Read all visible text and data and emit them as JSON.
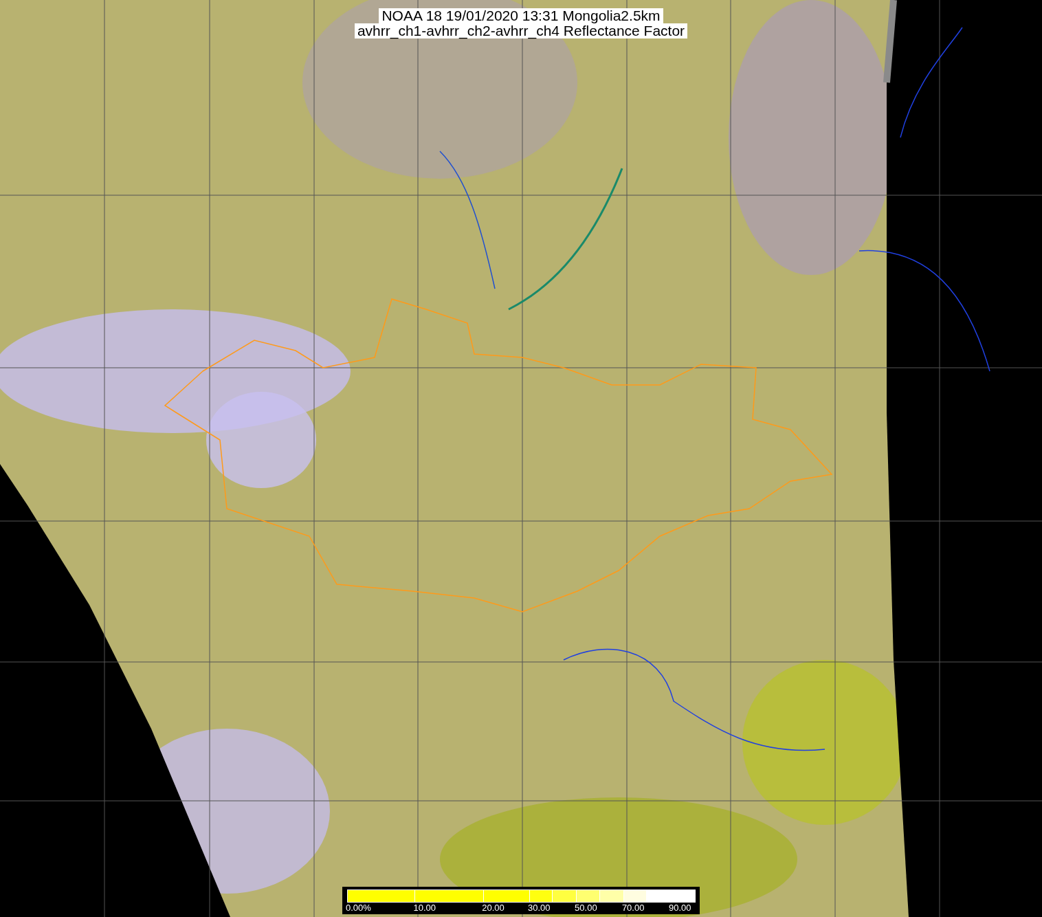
{
  "title": {
    "lines": [
      "NOAA 18 19/01/2020 13:31 Mongolia2.5km",
      "avhrr_ch1-avhrr_ch2-avhrr_ch4 Reflectance Factor"
    ]
  },
  "colorbar": {
    "segments": [
      {
        "color": "#ffff00",
        "label": "0.00%"
      },
      {
        "color": "#ffff00",
        "label": "10.00"
      },
      {
        "color": "#ffff00",
        "label": "20.00"
      },
      {
        "color": "#ffff10",
        "label": "30.00"
      },
      {
        "color": "#ffff40"
      },
      {
        "color": "#ffff70",
        "label": "50.00"
      },
      {
        "color": "#ffffa8"
      },
      {
        "color": "#fffde0",
        "label": "70.00"
      },
      {
        "color": "#ffffff"
      },
      {
        "color": "#ffffff",
        "label": "90.00"
      }
    ]
  }
}
